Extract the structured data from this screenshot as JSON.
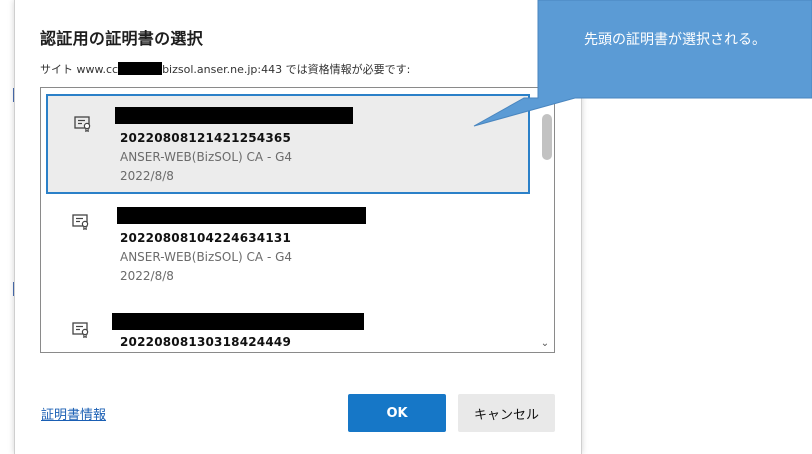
{
  "dialog": {
    "title": "認証用の証明書の選択",
    "subtitle_prefix": "サイト www.cc",
    "subtitle_suffix": "bizsol.anser.ne.jp:443 では資格情報が必要です:"
  },
  "certificates": [
    {
      "serial": "20220808121421254365",
      "issuer": "ANSER-WEB(BizSOL) CA - G4",
      "date": "2022/8/8",
      "selected": true
    },
    {
      "serial": "20220808104224634131",
      "issuer": "ANSER-WEB(BizSOL) CA - G4",
      "date": "2022/8/8",
      "selected": false
    },
    {
      "serial": "20220808130318424449",
      "issuer": "",
      "date": "",
      "selected": false
    }
  ],
  "footer": {
    "cert_info_link": "証明書情報",
    "ok_label": "OK",
    "cancel_label": "キャンセル"
  },
  "callout": {
    "text": "先頭の証明書が選択される。",
    "color": "#5b9bd5"
  },
  "icons": {
    "certificate": "certificate-icon",
    "scroll_up": "chevron-up-icon",
    "scroll_down": "chevron-down-icon"
  }
}
